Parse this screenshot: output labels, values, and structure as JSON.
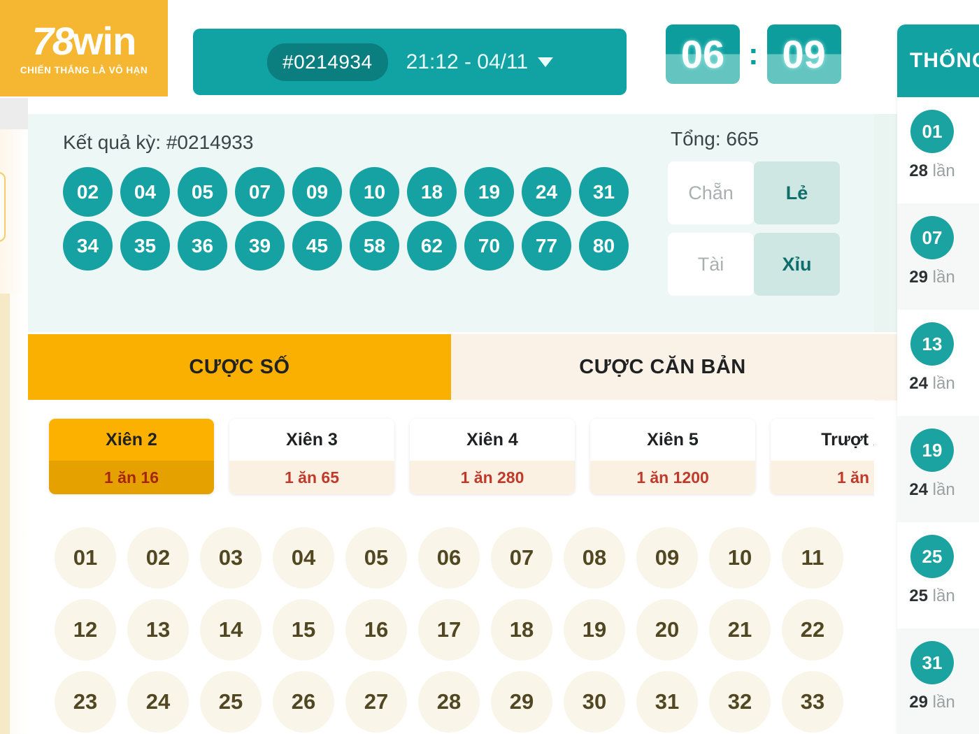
{
  "brand": {
    "logo_78": "78",
    "logo_win": "win",
    "tagline": "CHIẾN THẮNG LÀ VÔ HẠN"
  },
  "header": {
    "period_code": "#0214934",
    "period_time": "21:12 - 04/11",
    "dropdown_icon": "chevron-down-icon",
    "timer": {
      "minutes": "06",
      "separator": ":",
      "seconds": "09"
    },
    "panel_toggle_icon": "list-arrow-icon"
  },
  "results": {
    "title": "Kết quả kỳ: #0214933",
    "balls_row1": [
      "02",
      "04",
      "05",
      "07",
      "09",
      "10",
      "18",
      "19",
      "24",
      "31"
    ],
    "balls_row2": [
      "34",
      "35",
      "36",
      "39",
      "45",
      "58",
      "62",
      "70",
      "77",
      "80"
    ],
    "total_label": "Tổng: 665",
    "toggles": [
      {
        "left": "Chẵn",
        "right": "Lẻ",
        "active": "right"
      },
      {
        "left": "Tài",
        "right": "Xỉu",
        "active": "right"
      }
    ]
  },
  "tabs": [
    {
      "label": "CƯỢC SỐ",
      "active": true
    },
    {
      "label": "CƯỢC CĂN BẢN",
      "active": false
    }
  ],
  "bet_types": [
    {
      "title": "Xiên 2",
      "odds": "1 ăn 16",
      "active": true
    },
    {
      "title": "Xiên 3",
      "odds": "1 ăn 65",
      "active": false
    },
    {
      "title": "Xiên 4",
      "odds": "1 ăn 280",
      "active": false
    },
    {
      "title": "Xiên 5",
      "odds": "1 ăn 1200",
      "active": false
    },
    {
      "title": "Trượt X",
      "odds": "1 ăn",
      "active": false
    }
  ],
  "number_grid": {
    "row1": [
      "01",
      "02",
      "03",
      "04",
      "05",
      "06",
      "07",
      "08",
      "09",
      "10",
      "11"
    ],
    "row2": [
      "12",
      "13",
      "14",
      "15",
      "16",
      "17",
      "18",
      "19",
      "20",
      "21",
      "22"
    ],
    "row3": [
      "23",
      "24",
      "25",
      "26",
      "27",
      "28",
      "29",
      "30",
      "31",
      "32",
      "33"
    ]
  },
  "sidebar": {
    "title": "THỐNG KÊ",
    "rows": [
      {
        "num": "01",
        "count": "28",
        "unit": "lần"
      },
      {
        "num": "07",
        "count": "29",
        "unit": "lần"
      },
      {
        "num": "13",
        "count": "24",
        "unit": "lần"
      },
      {
        "num": "19",
        "count": "24",
        "unit": "lần"
      },
      {
        "num": "25",
        "count": "25",
        "unit": "lần"
      },
      {
        "num": "31",
        "count": "29",
        "unit": "lần"
      }
    ]
  },
  "colors": {
    "brand_orange": "#f5b731",
    "teal": "#12a2a1",
    "teal_dark": "#0b7f80",
    "tab_active": "#f9b000",
    "odds_red": "#c0392b",
    "ball_cream": "#faf5e9"
  }
}
